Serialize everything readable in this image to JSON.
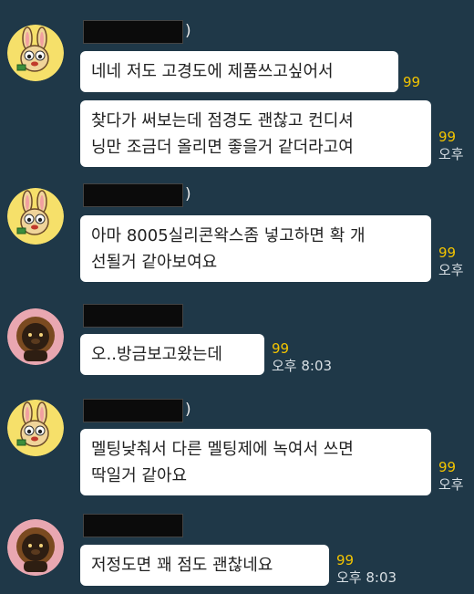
{
  "colors": {
    "background": "#1f3848",
    "bubble": "#ffffff",
    "unread": "#f3c400",
    "time": "#d8dfe4",
    "name_redaction": "#0b0b0b"
  },
  "messages": [
    {
      "sender_tail": ")",
      "avatar": "rabbit-character-icon",
      "bubbles": [
        {
          "text": "네네 저도 고경도에 제품쓰고싶어서",
          "unread": "99",
          "time": ""
        },
        {
          "text": "찾다가 써보는데 점경도 괜찮고 컨디셔\n닝만 조금더 올리면 좋을거 같더라고여",
          "unread": "99",
          "time": "오후"
        }
      ]
    },
    {
      "sender_tail": ")",
      "avatar": "rabbit-character-icon",
      "bubbles": [
        {
          "text": "아마 8005실리콘왁스좀 넣고하면 확 개\n선될거 같아보여요",
          "unread": "99",
          "time": "오후"
        }
      ]
    },
    {
      "sender_tail": "",
      "avatar": "lion-character-icon",
      "bubbles": [
        {
          "text": "오..방금보고왔는데",
          "unread": "99",
          "time": "오후 8:03"
        }
      ]
    },
    {
      "sender_tail": ")",
      "avatar": "rabbit-character-icon",
      "bubbles": [
        {
          "text": "멜팅낮춰서 다른 멜팅제에 녹여서 쓰면\n딱일거 같아요",
          "unread": "99",
          "time": "오후"
        }
      ]
    },
    {
      "sender_tail": "",
      "avatar": "lion-character-icon",
      "bubbles": [
        {
          "text": "저정도면 꽤 점도 괜찮네요",
          "unread": "99",
          "time": "오후 8:03"
        }
      ]
    }
  ]
}
